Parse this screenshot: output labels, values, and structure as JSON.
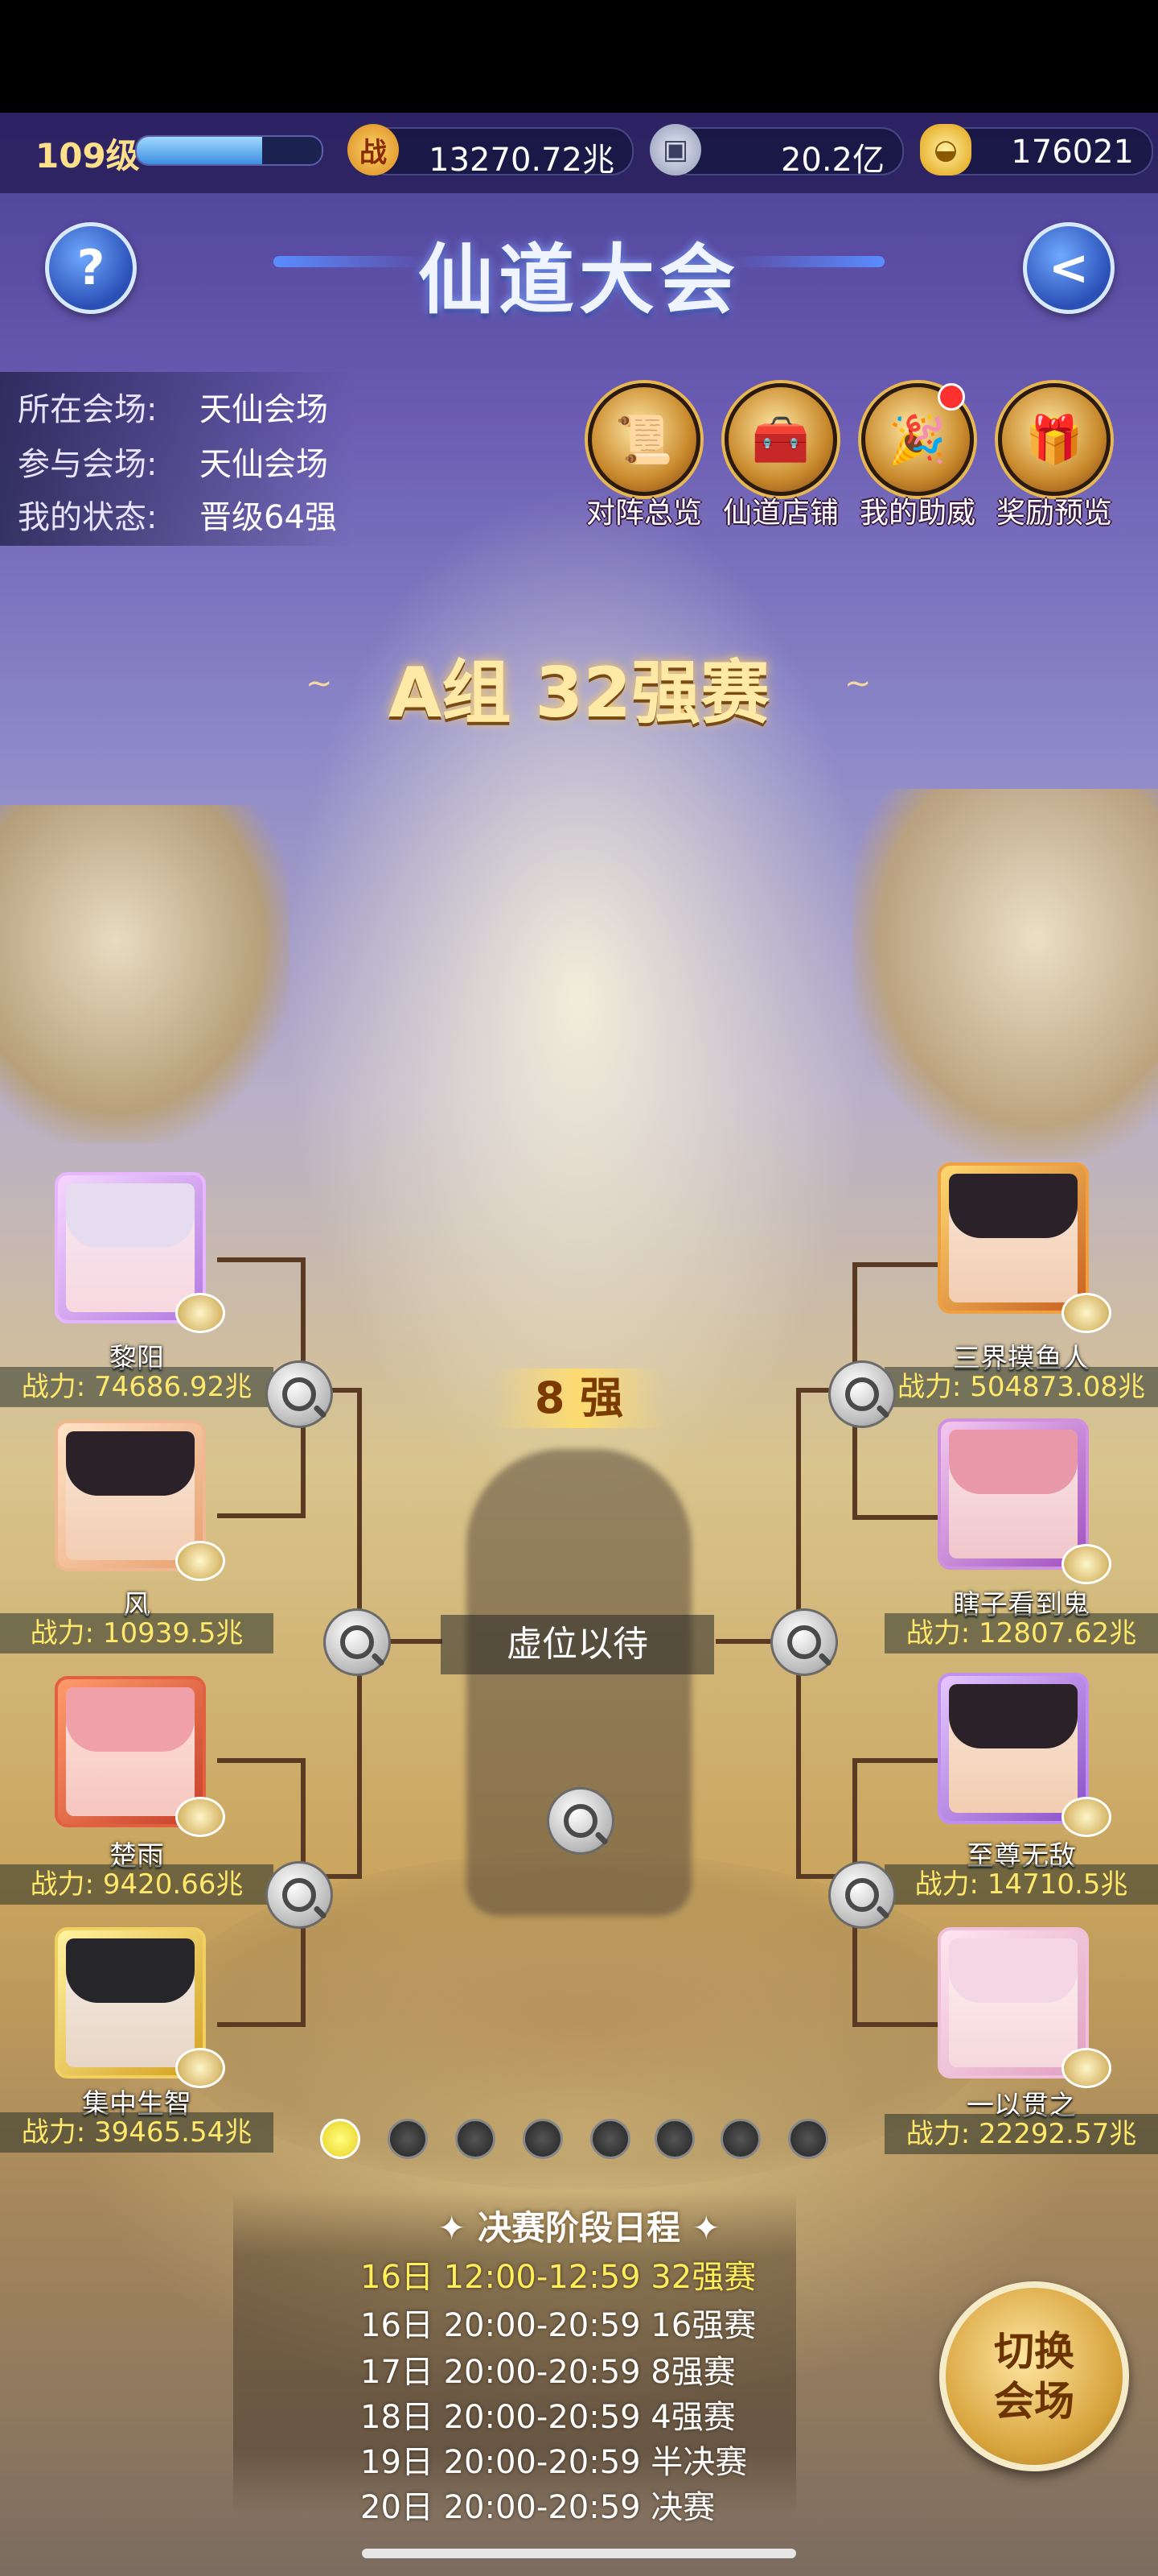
{
  "status_bar": {
    "level": "109级",
    "xp_progress": 0.68,
    "combat_power": "13270.72兆",
    "silver": "20.2亿",
    "gold": "176021",
    "power_icon_char": "战",
    "icons": [
      "combat-power-icon",
      "silver-coin-icon",
      "gold-ingot-icon"
    ]
  },
  "header": {
    "title": "仙道大会",
    "help_label": "?",
    "back_label": "<"
  },
  "info": {
    "venue_label": "所在会场:",
    "venue_value": "天仙会场",
    "joined_label": "参与会场:",
    "joined_value": "天仙会场",
    "status_label": "我的状态:",
    "status_value": "晋级64强"
  },
  "features": [
    {
      "label": "对阵总览",
      "icon": "scroll-icon"
    },
    {
      "label": "仙道店铺",
      "icon": "treasure-chest-icon"
    },
    {
      "label": "我的助威",
      "icon": "cheer-icon",
      "notification": true
    },
    {
      "label": "奖励预览",
      "icon": "reward-chest-icon"
    }
  ],
  "stage_title": "A组 32强赛",
  "stage_deco_left": "~",
  "stage_deco_right": "~",
  "center_label": "8 强",
  "waiting_label": "虚位以待",
  "left_players": [
    {
      "name": "黎阳",
      "power": "战力: 74686.92兆"
    },
    {
      "name": "风",
      "power": "战力: 10939.5兆"
    },
    {
      "name": "楚雨",
      "power": "战力: 9420.66兆"
    },
    {
      "name": "集中生智",
      "power": "战力: 39465.54兆"
    }
  ],
  "right_players": [
    {
      "name": "三界摸鱼人",
      "power": "战力: 504873.08兆"
    },
    {
      "name": "瞎子看到鬼",
      "power": "战力: 12807.62兆"
    },
    {
      "name": "至尊无敌",
      "power": "战力: 14710.5兆"
    },
    {
      "name": "一以贯之",
      "power": "战力: 22292.57兆"
    }
  ],
  "page_dots": {
    "count": 8,
    "active": 0
  },
  "schedule": {
    "title": "决赛阶段日程",
    "title_deco": "✦",
    "rows": [
      {
        "text": "16日 12:00-12:59 32强赛",
        "active": true
      },
      {
        "text": "16日 20:00-20:59 16强赛",
        "active": false
      },
      {
        "text": "17日 20:00-20:59 8强赛",
        "active": false
      },
      {
        "text": "18日 20:00-20:59 4强赛",
        "active": false
      },
      {
        "text": "19日 20:00-20:59 半决赛",
        "active": false
      },
      {
        "text": "20日 20:00-20:59 决赛",
        "active": false
      }
    ]
  },
  "switch_button": {
    "line1": "切换",
    "line2": "会场"
  },
  "colors": {
    "accent_gold": "#ffe86a",
    "active_row": "#ffee5a",
    "bracket_line": "#5a3a22"
  }
}
